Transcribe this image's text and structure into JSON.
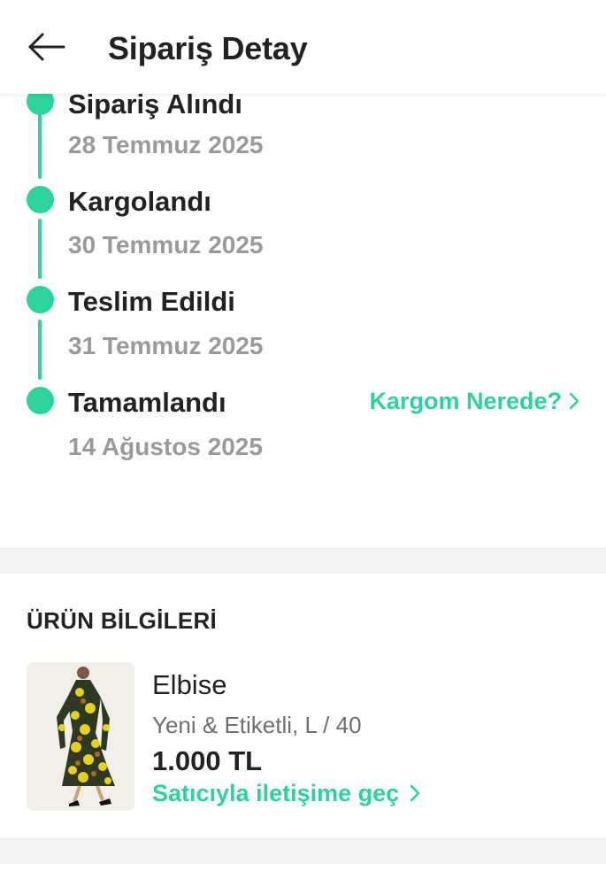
{
  "header": {
    "title": "Sipariş Detay",
    "back_icon": "arrow-left-icon"
  },
  "colors": {
    "accent": "#2dd49a",
    "muted": "#9a9a9a",
    "text": "#222222",
    "section_bg": "#f3f3f3"
  },
  "timeline": {
    "steps": [
      {
        "status": "Sipariş Alındı",
        "date": "28 Temmuz 2025"
      },
      {
        "status": "Kargolandı",
        "date": "30 Temmuz 2025"
      },
      {
        "status": "Teslim Edildi",
        "date": "31 Temmuz 2025"
      },
      {
        "status": "Tamamlandı",
        "date": "14 Ağustos 2025"
      }
    ],
    "track_link": "Kargom Nerede?"
  },
  "product_section": {
    "title": "ÜRÜN BİLGİLERİ",
    "product": {
      "name": "Elbise",
      "condition_size": "Yeni & Etiketli, L / 40",
      "price": "1.000 TL",
      "contact_link": "Satıcıyla iletişime geç"
    }
  }
}
